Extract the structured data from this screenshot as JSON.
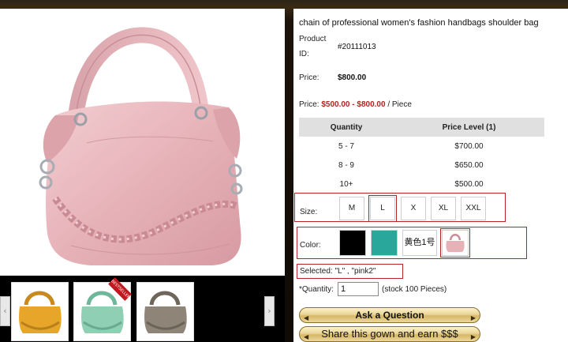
{
  "product": {
    "title": "chain of professional women's fashion handbags shoulder bag",
    "id_label": "Product ID:",
    "id_label_line1": "Product",
    "id_label_line2": "ID:",
    "id_value": "#20111013",
    "price_label": "Price:",
    "price_value": "$800.00",
    "range_prefix": "Price:",
    "range_value": "$500.00 - $800.00",
    "range_suffix": "/ Piece"
  },
  "tiers": {
    "headers": [
      "Quantity",
      "Price Level (1)"
    ],
    "rows": [
      [
        "5 - 7",
        "$700.00"
      ],
      [
        "8 - 9",
        "$650.00"
      ],
      [
        "10+",
        "$500.00"
      ]
    ]
  },
  "size": {
    "label": "Size:",
    "options": [
      "M",
      "L",
      "X",
      "XL",
      "XXL"
    ],
    "selected": "L"
  },
  "color": {
    "label": "Color:",
    "options": [
      {
        "name": "black",
        "hex": "#000000"
      },
      {
        "name": "teal",
        "hex": "#2aa79b"
      },
      {
        "name": "黄色1号",
        "text": "黄色1号"
      },
      {
        "name": "pink2",
        "image": "pink-bag-thumbnail"
      }
    ],
    "selected": "pink2"
  },
  "selected_text": "Selected:  \"L\" , \"pink2\"",
  "quantity": {
    "label": "*Quantity:",
    "value": "1",
    "stock": "(stock 100 Pieces)"
  },
  "buttons": {
    "ask": "Ask a Question",
    "share": "Share this gown and earn $$$"
  },
  "thumbnails": [
    {
      "name": "yellow-bag",
      "color": "#e7a52a"
    },
    {
      "name": "mint-bag",
      "color": "#8fcfb4",
      "badge": "BESTSELLER"
    },
    {
      "name": "grey-bag",
      "color": "#8e8478"
    }
  ],
  "colors": {
    "accent_red": "#b8232a",
    "price_red": "#b22222",
    "bag_pink": "#e8b7bd"
  }
}
